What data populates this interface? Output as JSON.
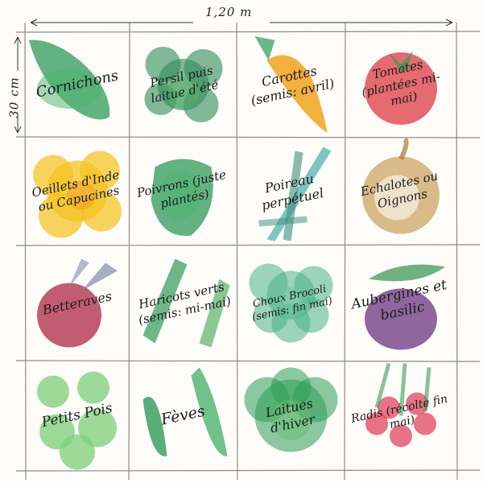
{
  "dimensions": {
    "width_label": "1,20 m",
    "height_label": "30 cm"
  },
  "plots": [
    {
      "name": "cornichons",
      "label": "Cornichons",
      "paint": [
        "#2f9a5a",
        "#4cb36e"
      ],
      "motif": "cucumber"
    },
    {
      "name": "persil",
      "label": "Persil puis laitue d'été",
      "paint": [
        "#2e8b57",
        "#58b26a"
      ],
      "motif": "parsley"
    },
    {
      "name": "carottes",
      "label": "Carottes (semis: avril)",
      "paint": [
        "#f0a21c",
        "#2f9a5a"
      ],
      "motif": "carrot"
    },
    {
      "name": "tomates",
      "label": "Tomates (plantées mi-mai)",
      "paint": [
        "#e0454f",
        "#3d9a5a"
      ],
      "motif": "tomato"
    },
    {
      "name": "oeillets",
      "label": "Oeillets d'Inde ou Capucines",
      "paint": [
        "#f3c21d",
        "#f0a21c"
      ],
      "motif": "flower"
    },
    {
      "name": "poivrons",
      "label": "Poivrons (juste plantés)",
      "paint": [
        "#2f9a5a",
        "#4cb36e"
      ],
      "motif": "pepper"
    },
    {
      "name": "poireau",
      "label": "Poireau perpétuel",
      "paint": [
        "#5fb7b0",
        "#3c8f7c"
      ],
      "motif": "leek"
    },
    {
      "name": "echalotes",
      "label": "Echalotes ou Oignons",
      "paint": [
        "#c8a05a",
        "#a8793b"
      ],
      "motif": "onion"
    },
    {
      "name": "betteraves",
      "label": "Betteraves",
      "paint": [
        "#b3344f",
        "#7e8fa8"
      ],
      "motif": "beet"
    },
    {
      "name": "haricots",
      "label": "Haricots verts (semis: mi-mai)",
      "paint": [
        "#2f9a5a",
        "#58b26a"
      ],
      "motif": "beans"
    },
    {
      "name": "choux",
      "label": "Choux Brocoli (semis: fin mai)",
      "paint": [
        "#4ab08a",
        "#6cc49e"
      ],
      "motif": "broccoli"
    },
    {
      "name": "aubergines",
      "label": "Aubergines et basilic",
      "paint": [
        "#7b4b8e",
        "#3d9a5a"
      ],
      "motif": "eggplant"
    },
    {
      "name": "petits-pois",
      "label": "Petits Pois",
      "paint": [
        "#7ccf7a",
        "#5fbf6a"
      ],
      "motif": "peas"
    },
    {
      "name": "feves",
      "label": "Fèves",
      "paint": [
        "#2f9a5a",
        "#4cb36e"
      ],
      "motif": "pods"
    },
    {
      "name": "laitues",
      "label": "Laitues d'hiver",
      "paint": [
        "#2e9c55",
        "#63be72"
      ],
      "motif": "lettuce"
    },
    {
      "name": "radis",
      "label": "Radis (récolte fin mai)",
      "paint": [
        "#e0455f",
        "#3d9a5a"
      ],
      "motif": "radish"
    }
  ]
}
